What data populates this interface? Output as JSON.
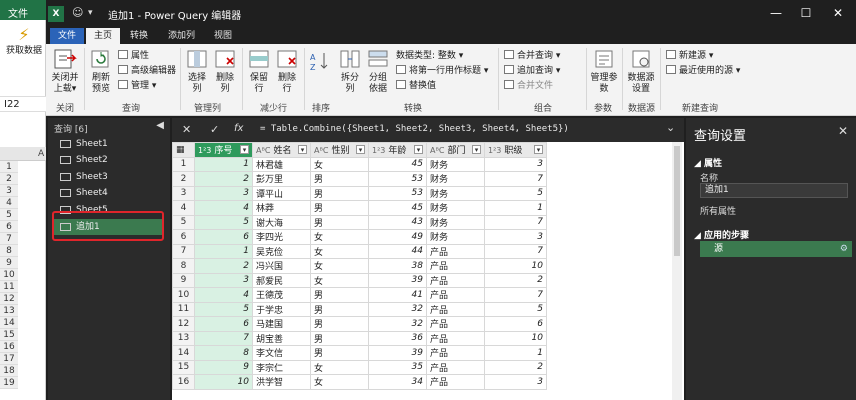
{
  "excel": {
    "file_tab": "文件",
    "get_data_label": "获取数据",
    "name_box": "I22",
    "col_header": "A",
    "row_numbers": [
      "1",
      "2",
      "3",
      "4",
      "5",
      "6",
      "7",
      "8",
      "9",
      "10",
      "11",
      "12",
      "13",
      "14",
      "15",
      "16",
      "17",
      "18",
      "19"
    ]
  },
  "window": {
    "title": "追加1 - Power Query 编辑器",
    "emoji": "☺",
    "dropdown": "▾",
    "minimize": "—",
    "maximize": "☐",
    "close": "✕"
  },
  "tabs": [
    "文件",
    "主页",
    "转换",
    "添加列",
    "视图"
  ],
  "ribbon": {
    "close_upload": "关闭并上载",
    "close_upload_dd": "▾",
    "refresh_preview": "刷新预览",
    "properties": "属性",
    "advanced_editor": "高级编辑器",
    "manage": "管理",
    "choose_columns": "选择列",
    "remove_columns": "删除列",
    "keep_rows": "保留行",
    "remove_rows": "删除行",
    "split_column": "拆分列",
    "group_by": "分组依据",
    "data_type": "数据类型: 整数",
    "first_row_header": "将第一行用作标题",
    "replace_values": "替换值",
    "merge_queries": "合并查询",
    "append_queries": "追加查询",
    "combine_files": "合并文件",
    "manage_params": "管理参数",
    "data_source_settings": "数据源设置",
    "new_source": "新建源",
    "recent_sources": "最近使用的源",
    "groups": {
      "close": "关闭",
      "query": "查询",
      "manage_columns": "管理列",
      "reduce_rows": "减少行",
      "sort": "排序",
      "transform": "转换",
      "combine": "组合",
      "params": "参数",
      "data_source": "数据源",
      "new_query": "新建查询"
    }
  },
  "queries": {
    "header": "查询 [6]",
    "collapse": "◀",
    "items": [
      "Sheet1",
      "Sheet2",
      "Sheet3",
      "Sheet4",
      "Sheet5",
      "追加1"
    ]
  },
  "formula": {
    "cancel": "✕",
    "confirm": "✓",
    "fx": "fx",
    "text": "= Table.Combine({Sheet1, Sheet2, Sheet3, Sheet4, Sheet5})",
    "expand": "⌄"
  },
  "table": {
    "columns": [
      {
        "type": "1²3",
        "name": "序号"
      },
      {
        "type": "AᴮC",
        "name": "姓名"
      },
      {
        "type": "AᴮC",
        "name": "性别"
      },
      {
        "type": "1²3",
        "name": "年龄"
      },
      {
        "type": "AᴮC",
        "name": "部门"
      },
      {
        "type": "1²3",
        "name": "职级"
      }
    ],
    "rows": [
      [
        "1",
        "1",
        "林君雄",
        "女",
        "45",
        "财务",
        "3"
      ],
      [
        "2",
        "2",
        "彭万里",
        "男",
        "53",
        "财务",
        "7"
      ],
      [
        "3",
        "3",
        "谭平山",
        "男",
        "53",
        "财务",
        "5"
      ],
      [
        "4",
        "4",
        "林莽",
        "男",
        "45",
        "财务",
        "1"
      ],
      [
        "5",
        "5",
        "谢大海",
        "男",
        "43",
        "财务",
        "7"
      ],
      [
        "6",
        "6",
        "李四光",
        "女",
        "49",
        "财务",
        "3"
      ],
      [
        "7",
        "1",
        "吴克俭",
        "女",
        "44",
        "产品",
        "7"
      ],
      [
        "8",
        "2",
        "冯兴国",
        "女",
        "38",
        "产品",
        "10"
      ],
      [
        "9",
        "3",
        "郝爱民",
        "女",
        "39",
        "产品",
        "2"
      ],
      [
        "10",
        "4",
        "王德茂",
        "男",
        "41",
        "产品",
        "7"
      ],
      [
        "11",
        "5",
        "于学忠",
        "男",
        "32",
        "产品",
        "5"
      ],
      [
        "12",
        "6",
        "马建国",
        "男",
        "32",
        "产品",
        "6"
      ],
      [
        "13",
        "7",
        "胡宝善",
        "男",
        "36",
        "产品",
        "10"
      ],
      [
        "14",
        "8",
        "李文信",
        "男",
        "39",
        "产品",
        "1"
      ],
      [
        "15",
        "9",
        "李宗仁",
        "女",
        "35",
        "产品",
        "2"
      ],
      [
        "16",
        "10",
        "洪学智",
        "女",
        "34",
        "产品",
        "3"
      ]
    ]
  },
  "settings": {
    "title": "查询设置",
    "close": "✕",
    "properties": "◢ 属性",
    "name_label": "名称",
    "name_value": "追加1",
    "all_props": "所有属性",
    "applied_steps": "◢ 应用的步骤",
    "step": "源",
    "gear": "⚙"
  }
}
